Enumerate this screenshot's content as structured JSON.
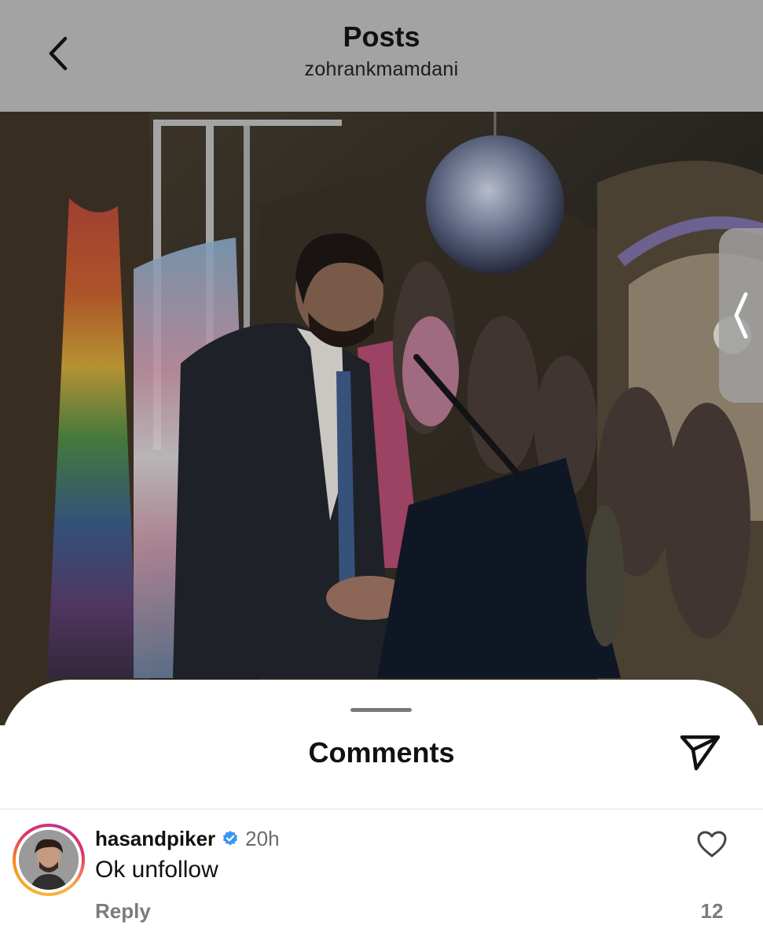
{
  "header": {
    "title": "Posts",
    "username": "zohrankmamdani",
    "back_icon": "chevron-left-icon",
    "background": "#a3a3a3"
  },
  "photo": {
    "description_icon": "post-photo",
    "side_tab_icon": "chevron-left-icon"
  },
  "comments_sheet": {
    "title": "Comments",
    "share_icon": "paper-plane-icon"
  },
  "comments": [
    {
      "username": "hasandpiker",
      "verified": true,
      "time": "20h",
      "text": "Ok unfollow",
      "reply_label": "Reply",
      "like_count": "12",
      "like_icon": "heart-outline-icon"
    }
  ],
  "colors": {
    "verified_blue": "#3897f0",
    "muted_text": "#7c7c7c"
  }
}
